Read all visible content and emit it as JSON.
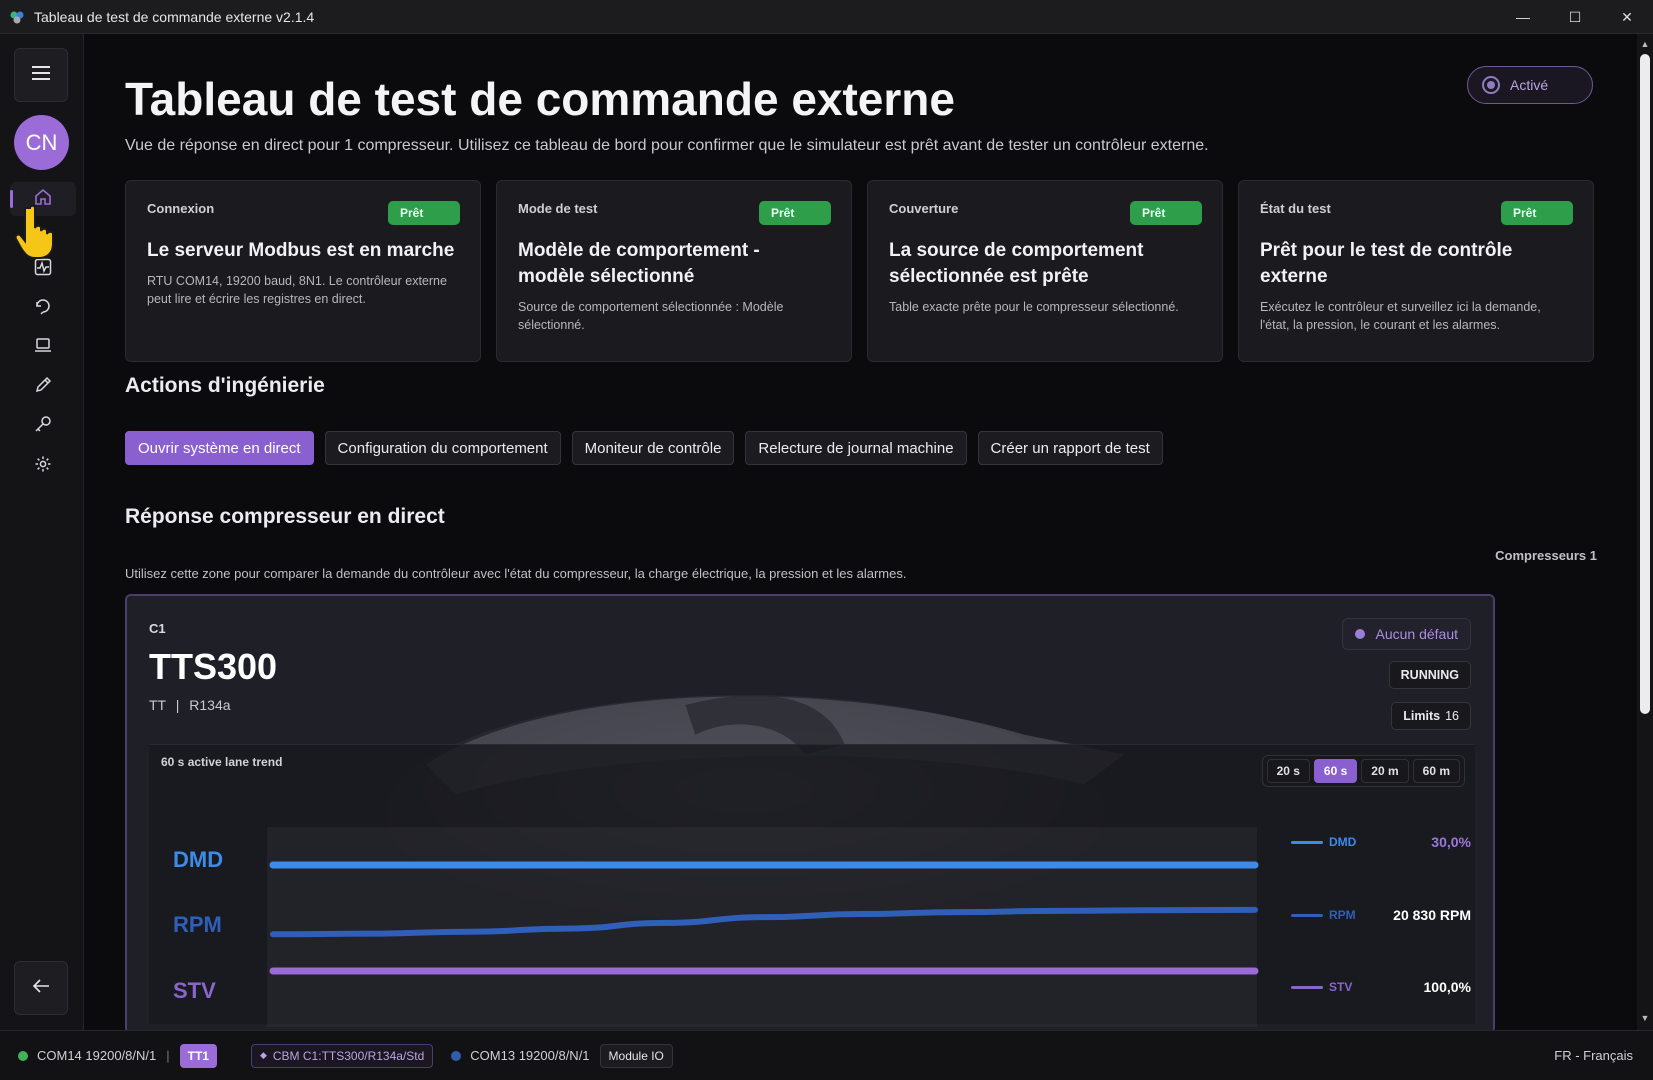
{
  "window": {
    "title": "Tableau de test de commande externe v2.1.4",
    "minimize": "—",
    "maximize": "☐",
    "close": "✕"
  },
  "sidebar": {
    "avatar": "CN",
    "items": [
      {
        "name": "home-icon",
        "active": true
      },
      {
        "name": "pulse-monitor-icon"
      },
      {
        "name": "replay-icon"
      },
      {
        "name": "laptop-icon"
      },
      {
        "name": "pen-icon"
      },
      {
        "name": "key-icon"
      },
      {
        "name": "gear-icon"
      }
    ]
  },
  "header": {
    "title": "Tableau de test de commande externe",
    "subtitle": "Vue de réponse en direct pour 1 compresseur. Utilisez ce tableau de bord pour confirmer que le simulateur est prêt avant de tester un contrôleur externe.",
    "status_pill": "Activé"
  },
  "cards": [
    {
      "label": "Connexion",
      "badge": "Prêt",
      "heading": "Le serveur Modbus est en marche",
      "desc": "RTU COM14, 19200 baud, 8N1. Le contrôleur externe peut lire et écrire les registres en direct."
    },
    {
      "label": "Mode de test",
      "badge": "Prêt",
      "heading": "Modèle de comportement - modèle sélectionné",
      "desc": "Source de comportement sélectionnée : Modèle sélectionné."
    },
    {
      "label": "Couverture",
      "badge": "Prêt",
      "heading": "La source de comportement sélectionnée est prête",
      "desc": "Table exacte prête pour le compresseur sélectionné."
    },
    {
      "label": "État du test",
      "badge": "Prêt",
      "heading": "Prêt pour le test de contrôle externe",
      "desc": "Exécutez le contrôleur et surveillez ici la demande, l'état, la pression, le courant et les alarmes."
    }
  ],
  "actions": {
    "title": "Actions d'ingénierie",
    "buttons": [
      "Ouvrir système en direct",
      "Configuration du comportement",
      "Moniteur de contrôle",
      "Relecture de journal machine",
      "Créer un rapport de test"
    ]
  },
  "response": {
    "title": "Réponse compresseur en direct",
    "subtitle": "Utilisez cette zone pour comparer la demande du contrôleur avec l'état du compresseur, la charge électrique, la pression et les alarmes.",
    "count": "Compresseurs 1"
  },
  "compressor": {
    "id": "C1",
    "model": "TTS300",
    "type": "TT",
    "refrigerant": "R134a",
    "separator": "|",
    "fault": "Aucun défaut",
    "state": "RUNNING",
    "limits_label": "Limits",
    "limits_value": "16"
  },
  "trend": {
    "title": "60 s active lane trend",
    "ranges": [
      "20 s",
      "60 s",
      "20 m",
      "60 m"
    ],
    "active_range": "60 s",
    "lanes": [
      {
        "name": "DMD",
        "value": "30,0%",
        "color": "#3d8be8"
      },
      {
        "name": "RPM",
        "value": "20 830 RPM",
        "color": "#2f6fd6"
      },
      {
        "name": "STV",
        "value": "100,0%",
        "color": "#9b6bd8"
      }
    ]
  },
  "chart_data": {
    "type": "line",
    "title": "60 s active lane trend",
    "series": [
      {
        "name": "DMD",
        "values": [
          30.0,
          30.0,
          30.0,
          30.0,
          30.0,
          30.0,
          30.0,
          30.0,
          30.0,
          30.0,
          30.0
        ]
      },
      {
        "name": "RPM",
        "values": [
          18900,
          18950,
          19100,
          19350,
          19800,
          20250,
          20500,
          20650,
          20750,
          20800,
          20830
        ]
      },
      {
        "name": "STV",
        "values": [
          100.0,
          100.0,
          100.0,
          100.0,
          100.0,
          100.0,
          100.0,
          100.0,
          100.0,
          100.0,
          100.0
        ]
      }
    ]
  },
  "statusbar": {
    "port1": "COM14 19200/8/N/1",
    "sep": "|",
    "chip1": "TT1",
    "chip2": "CBM C1:TTS300/R134a/Std",
    "port2": "COM13 19200/8/N/1",
    "chip3": "Module IO",
    "language": "FR - Français"
  }
}
